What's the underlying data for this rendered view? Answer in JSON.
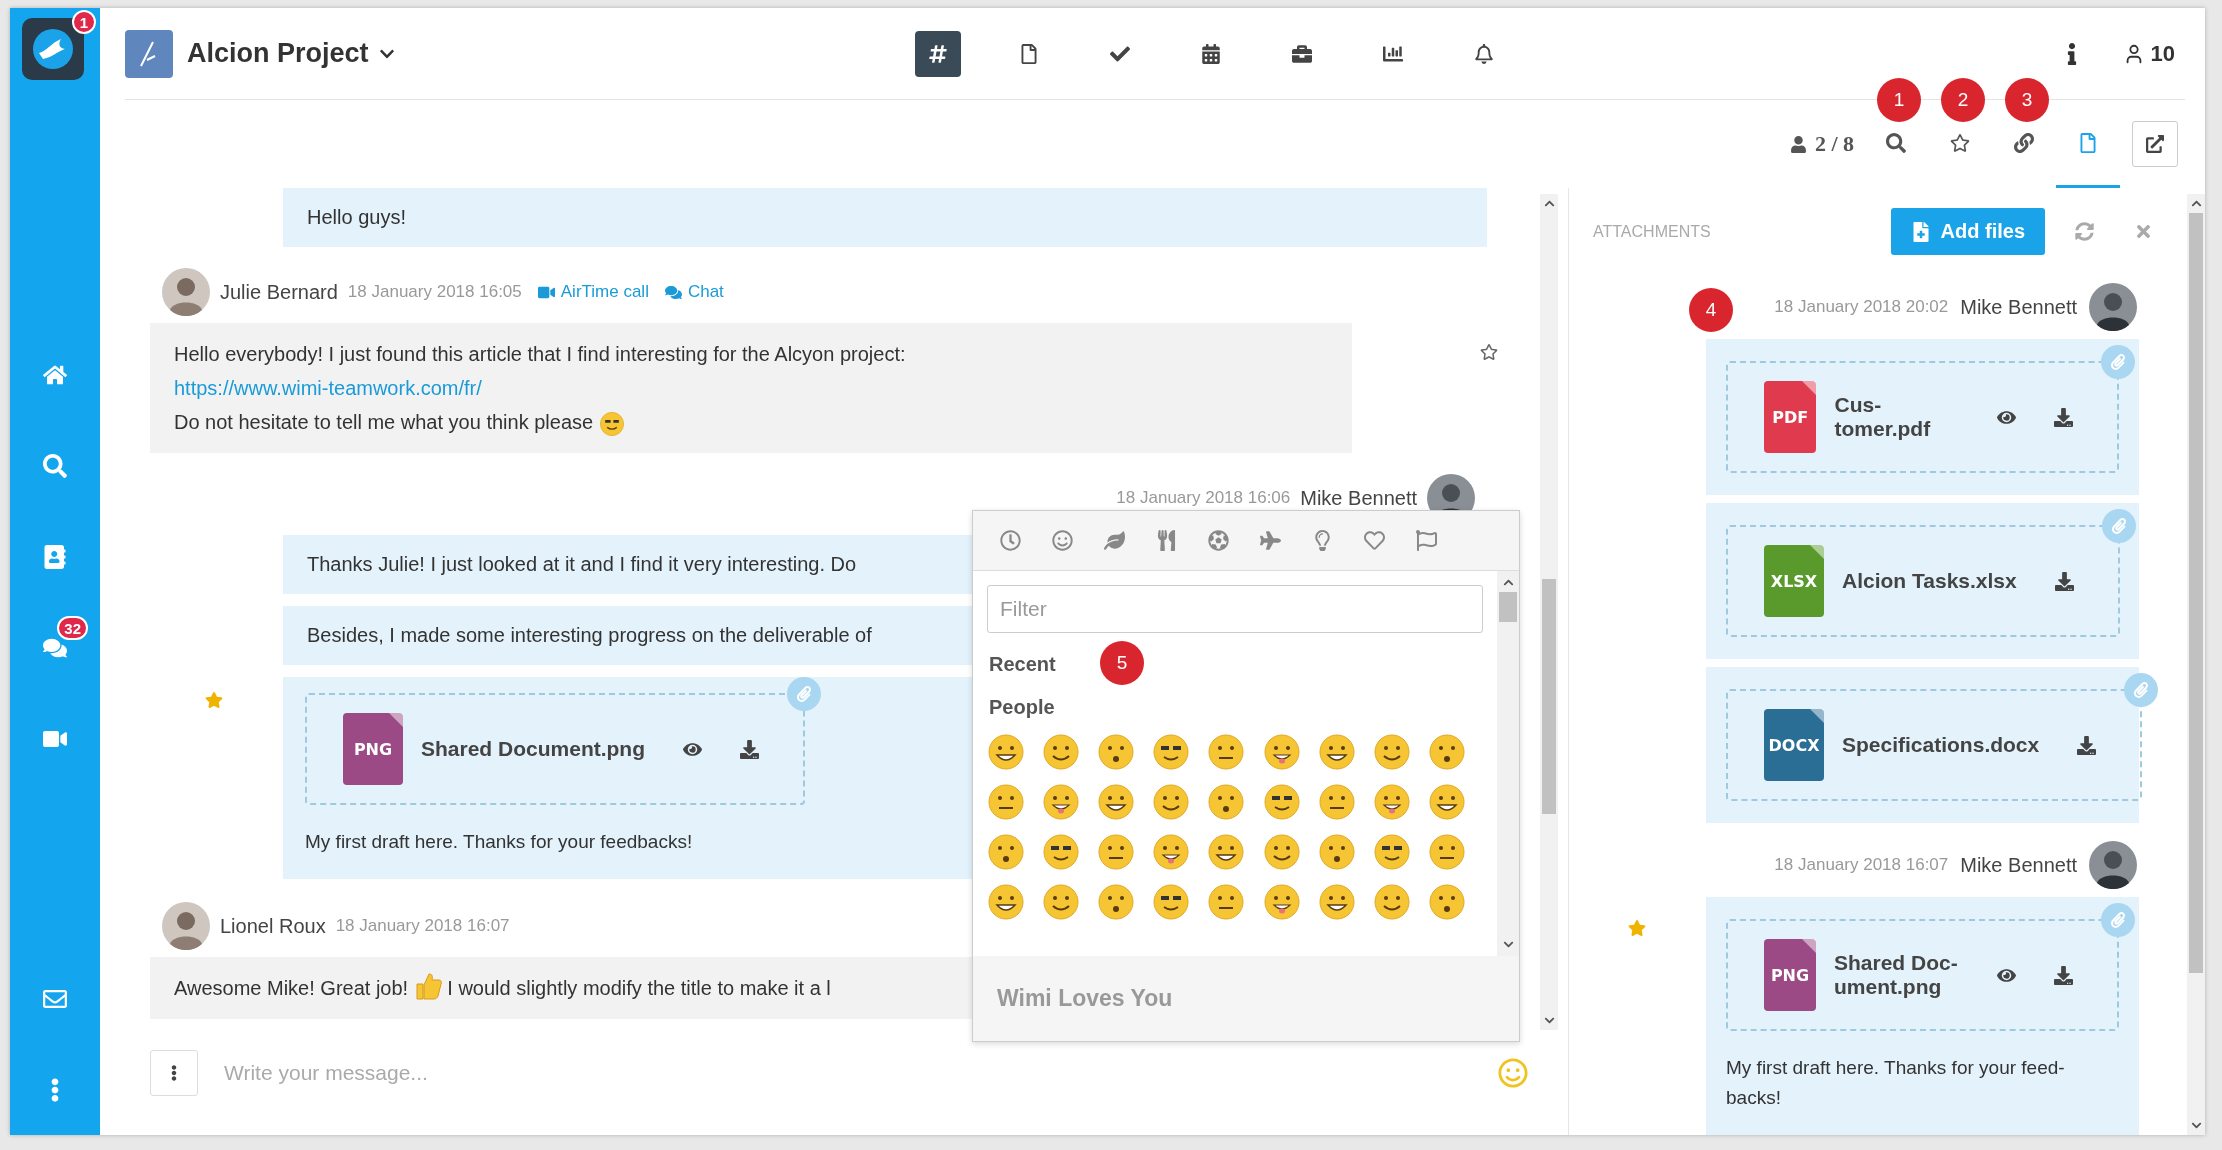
{
  "sidebar": {
    "logo_badge": "1",
    "chat_badge": "32"
  },
  "header": {
    "project": "Alcion Project",
    "toolbar": [
      {
        "selected": true
      },
      {
        "selected": false
      },
      {
        "selected": false
      },
      {
        "selected": false
      },
      {
        "selected": false
      },
      {
        "selected": false
      },
      {
        "selected": false
      }
    ],
    "members": "10"
  },
  "subbar": {
    "online": "2 / 8",
    "tools": [
      {
        "selected": false
      },
      {
        "selected": false
      },
      {
        "selected": false
      },
      {
        "selected": true
      }
    ]
  },
  "annotations": [
    {
      "label": "1"
    },
    {
      "label": "2"
    },
    {
      "label": "3"
    },
    {
      "label": "4"
    },
    {
      "label": "5"
    }
  ],
  "chat": {
    "entries": [
      {
        "kind": "own",
        "text": "Hello guys!"
      },
      {
        "kind": "author",
        "name": "Julie Bernard",
        "time": "18 January 2018 16:05",
        "actions": [
          "AirTime call",
          "Chat"
        ]
      },
      {
        "kind": "other",
        "text": "Hello everybody! I just found this article that I find interesting for the Alcyon project:",
        "link": "https://www.wimi-teamwork.com/fr/",
        "text_after": "Do not hesitate to tell me what you think please",
        "starred": false
      },
      {
        "kind": "own_author",
        "name": "Mike Bennett",
        "time": "18 January 2018 16:06"
      },
      {
        "kind": "own",
        "text": "Thanks Julie! I just looked at it and I find it very interesting. Do"
      },
      {
        "kind": "own",
        "text": "Besides, I made some interesting progress on the deliverable of"
      },
      {
        "kind": "own_file",
        "starred": true,
        "file": {
          "type": "PNG",
          "color": "#9b4a86",
          "name": "Shared Document.png",
          "preview": true
        },
        "text": "My first draft here. Thanks for your feedbacks!"
      },
      {
        "kind": "author",
        "name": "Lionel Roux",
        "time": "18 January 2018 16:07"
      },
      {
        "kind": "other",
        "text": "Awesome Mike!  Great job!",
        "text_after": "I would slightly modify the title to make it a l"
      }
    ]
  },
  "composer": {
    "placeholder": "Write your message..."
  },
  "emoji_picker": {
    "filter_placeholder": "Filter",
    "sections": [
      "Recent",
      "People"
    ],
    "footer": "Wimi Loves You"
  },
  "attachments": {
    "title": "ATTACHMENTS",
    "add_button": "Add files",
    "groups": [
      {
        "time": "18 January 2018 20:02",
        "author": "Mike Bennett",
        "items": [
          {
            "file": {
              "type": "PDF",
              "color": "#e03a4f",
              "name": "Cus-tomer.pdf",
              "preview": true
            }
          },
          {
            "file": {
              "type": "XLSX",
              "color": "#5a9a2c",
              "name": "Alcion Tasks.xlsx",
              "preview": false
            }
          },
          {
            "file": {
              "type": "DOCX",
              "color": "#2a6d95",
              "name": "Specifications.docx",
              "preview": false
            }
          }
        ]
      },
      {
        "time": "18 January 2018 16:07",
        "author": "Mike Bennett",
        "items": [
          {
            "starred": true,
            "file": {
              "type": "PNG",
              "color": "#9b4a86",
              "name": "Shared Doc-ument.png",
              "preview": true
            },
            "text": "My first draft here. Thanks for your feed-backs!"
          }
        ]
      }
    ]
  }
}
